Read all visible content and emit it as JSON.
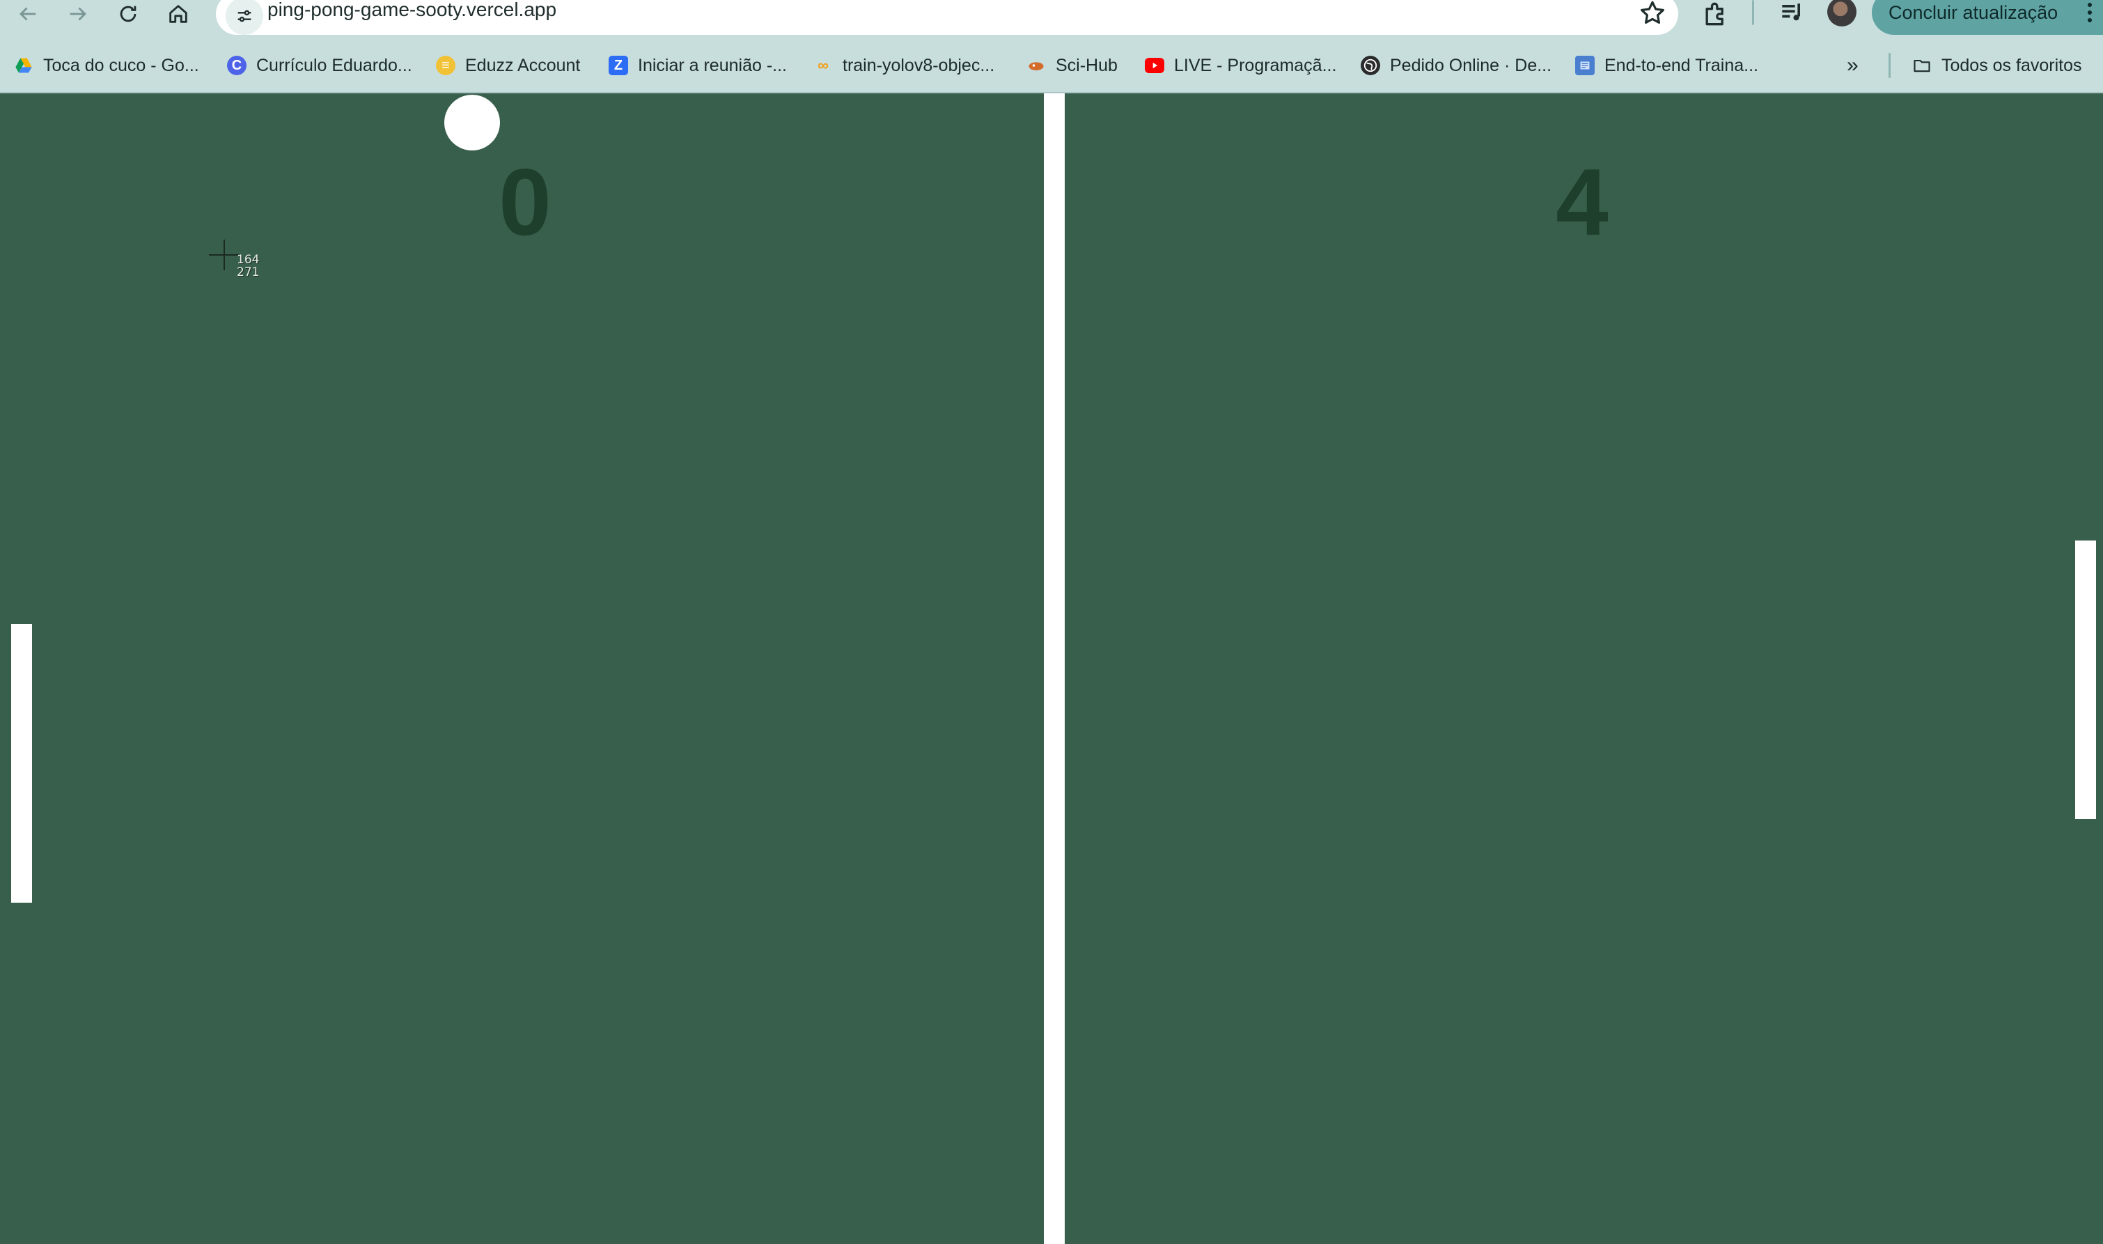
{
  "browser": {
    "url": "ping-pong-game-sooty.vercel.app",
    "update_button_label": "Concluir atualização",
    "bookmarks": [
      {
        "label": "Toca do cuco - Go...",
        "icon": "google-drive-icon",
        "color": "#f4b400"
      },
      {
        "label": "Currículo Eduardo...",
        "icon": "canva-icon",
        "color": "#4d64e8"
      },
      {
        "label": "Eduzz Account",
        "icon": "eduzz-icon",
        "color": "#f2c236"
      },
      {
        "label": "Iniciar a reunião -...",
        "icon": "zoom-icon",
        "color": "#2d6df6"
      },
      {
        "label": "train-yolov8-objec...",
        "icon": "colab-icon",
        "color": "#f39c12"
      },
      {
        "label": "Sci-Hub",
        "icon": "scihub-icon",
        "color": "#d36b2a"
      },
      {
        "label": "LIVE - Programaçã...",
        "icon": "youtube-icon",
        "color": "#ff0000"
      },
      {
        "label": "Pedido Online · De...",
        "icon": "globe-icon",
        "color": "#2b2b2b"
      },
      {
        "label": "End-to-end Traina...",
        "icon": "doc-icon",
        "color": "#4a7fd0"
      }
    ],
    "all_bookmarks_label": "Todos os favoritos"
  },
  "game": {
    "score_left": "0",
    "score_right": "4",
    "cursor_x": "164",
    "cursor_y": "271",
    "colors": {
      "table": "#385f4b",
      "score": "#1d3f2c",
      "ball": "#ffffff",
      "paddle": "#ffffff",
      "net": "#ffffff"
    }
  }
}
